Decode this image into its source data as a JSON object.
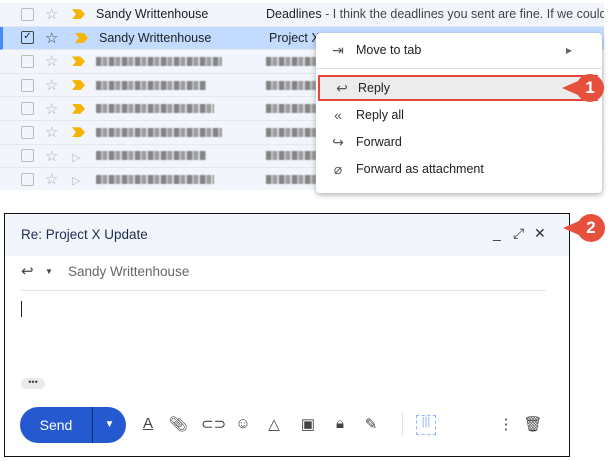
{
  "inbox": {
    "rows": [
      {
        "sender": "Sandy Writtenhouse",
        "subject": "Deadlines",
        "snippet": " - I think the deadlines you sent are fine. If we could m",
        "selected": false,
        "important": true
      },
      {
        "sender": "Sandy Writtenhouse",
        "subject": "Project X",
        "snippet": "",
        "selected": true,
        "important": true
      },
      {
        "blurred": true,
        "important": true
      },
      {
        "blurred": true,
        "important": true
      },
      {
        "blurred": true,
        "important": true
      },
      {
        "blurred": true,
        "important": true
      },
      {
        "blurred": true,
        "important": false
      },
      {
        "blurred": true,
        "important": false
      }
    ]
  },
  "menu": {
    "items": [
      {
        "label": "Move to tab",
        "icon": "move-to-tab-icon"
      },
      {
        "label": "Reply",
        "icon": "reply-icon"
      },
      {
        "label": "Reply all",
        "icon": "reply-all-icon"
      },
      {
        "label": "Forward",
        "icon": "forward-icon"
      },
      {
        "label": "Forward as attachment",
        "icon": "attachment-icon"
      }
    ]
  },
  "badges": {
    "one": "1",
    "two": "2"
  },
  "compose": {
    "title": "Re: Project X Update",
    "recipient": "Sandy Writtenhouse",
    "more": "•••",
    "send": "Send"
  },
  "colors": {
    "accent": "#2559d0",
    "callout": "#e8503e",
    "highlight": "#e8453c"
  }
}
